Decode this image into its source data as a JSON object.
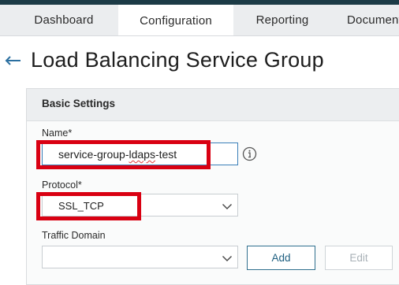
{
  "nav": {
    "tabs": [
      {
        "label": "Dashboard",
        "active": false
      },
      {
        "label": "Configuration",
        "active": true
      },
      {
        "label": "Reporting",
        "active": false
      },
      {
        "label": "Documentation",
        "active": false
      }
    ]
  },
  "page": {
    "title": "Load Balancing Service Group",
    "back_icon": "back-arrow-icon"
  },
  "basic_settings": {
    "header": "Basic Settings",
    "name": {
      "label": "Name*",
      "value_prefix": "service-group-",
      "value_misspelled": "ldaps",
      "value_suffix": "-test",
      "info_icon": "info-icon"
    },
    "protocol": {
      "label": "Protocol*",
      "selected": "SSL_TCP"
    },
    "traffic_domain": {
      "label": "Traffic Domain",
      "selected": ""
    },
    "buttons": {
      "add_label": "Add",
      "edit_label": "Edit"
    }
  },
  "colors": {
    "top_bar": "#1c3b46",
    "highlight": "#d90012",
    "input_focus_border": "#3a7fb8",
    "add_button_border": "#2f6f8e"
  }
}
